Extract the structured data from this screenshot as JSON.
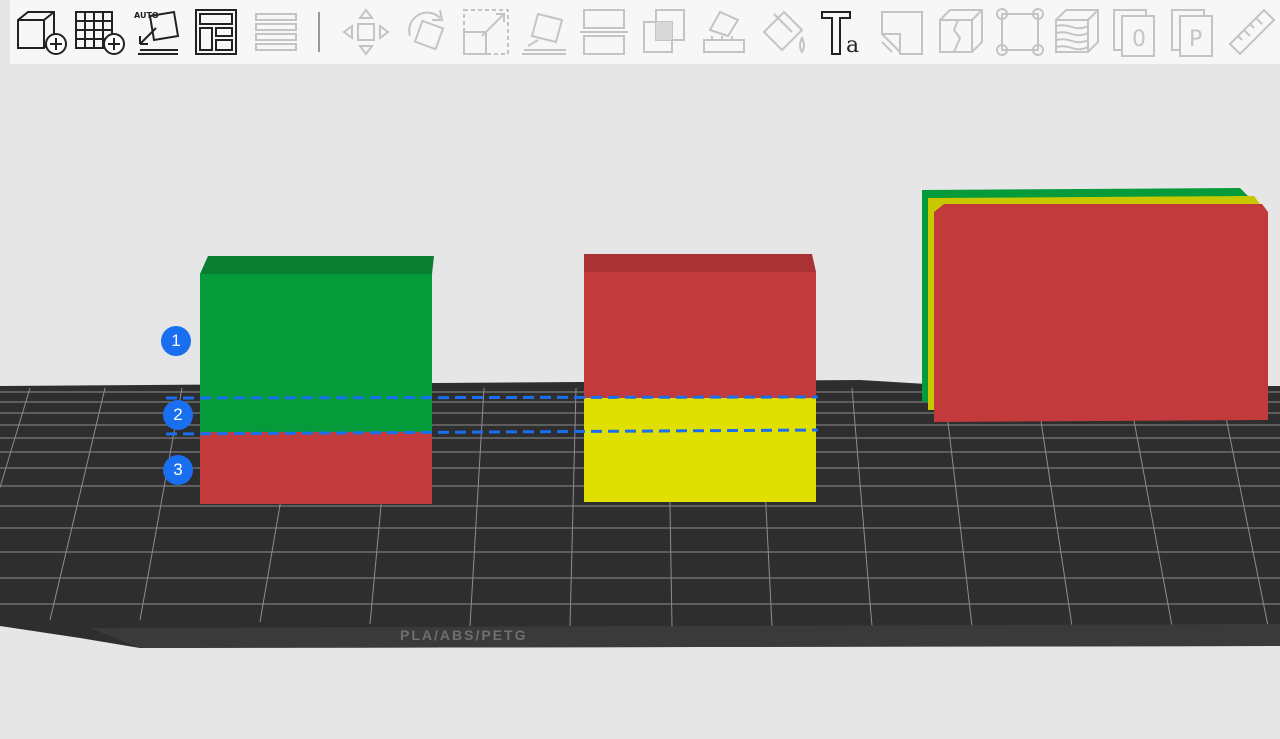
{
  "toolbar": {
    "buttons": [
      {
        "icon": "add-object-icon",
        "enabled": true
      },
      {
        "icon": "add-plate-icon",
        "enabled": true
      },
      {
        "icon": "auto-orient-icon",
        "enabled": true,
        "label": "AUTO"
      },
      {
        "icon": "arrange-icon",
        "enabled": true
      },
      {
        "icon": "layers-icon",
        "enabled": false
      },
      {
        "icon": "move-icon",
        "enabled": false
      },
      {
        "icon": "rotate-icon",
        "enabled": false
      },
      {
        "icon": "scale-icon",
        "enabled": false
      },
      {
        "icon": "lay-on-face-icon",
        "enabled": false
      },
      {
        "icon": "cut-icon",
        "enabled": false
      },
      {
        "icon": "boolean-icon",
        "enabled": false
      },
      {
        "icon": "support-painting-icon",
        "enabled": false
      },
      {
        "icon": "color-painting-icon",
        "enabled": false
      },
      {
        "icon": "text-icon",
        "enabled": true,
        "label": "Ta"
      },
      {
        "icon": "seam-painting-icon",
        "enabled": false
      },
      {
        "icon": "split-icon",
        "enabled": false
      },
      {
        "icon": "measure-bounds-icon",
        "enabled": false
      },
      {
        "icon": "variable-layer-height-icon",
        "enabled": false
      },
      {
        "icon": "object-plate-icon",
        "enabled": false,
        "label": "0"
      },
      {
        "icon": "part-plate-icon",
        "enabled": false,
        "label": "P"
      },
      {
        "icon": "ruler-icon",
        "enabled": false
      }
    ]
  },
  "viewport": {
    "bed_label": "PLA/ABS/PETG",
    "markers": [
      {
        "label": "1"
      },
      {
        "label": "2"
      },
      {
        "label": "3"
      }
    ],
    "objects": [
      {
        "name": "object-1",
        "segments": [
          "green",
          "red"
        ]
      },
      {
        "name": "object-2",
        "segments": [
          "red",
          "yellow"
        ]
      },
      {
        "name": "object-3",
        "layers": [
          "green",
          "yellow",
          "red"
        ]
      }
    ],
    "colors": {
      "green": "#059a3a",
      "green_top": "#0a7f32",
      "red": "#c23a3c",
      "red_top": "#a83234",
      "yellow": "#e0e000",
      "yellow_edge": "#c4c400",
      "bed": "#2e2e2e",
      "grid": "#8d8d8d",
      "background": "#e6e6e6",
      "marker": "#1a6ef0",
      "dash": "#1a6ef0"
    }
  }
}
